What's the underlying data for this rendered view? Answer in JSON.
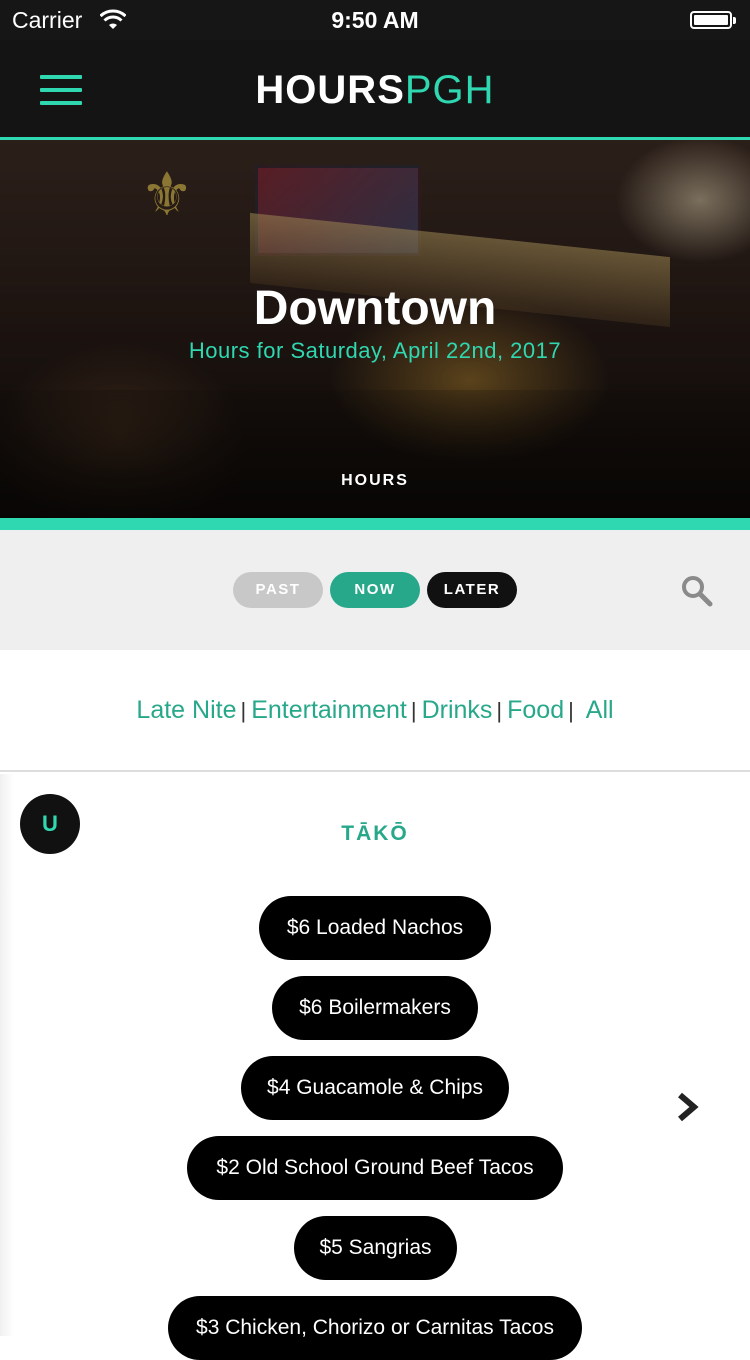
{
  "status_bar": {
    "carrier": "Carrier",
    "time": "9:50 AM",
    "icons": [
      "wifi-icon",
      "battery-icon"
    ]
  },
  "header": {
    "logo_main": "HOURS",
    "logo_accent": "PGH",
    "menu_icon": "hamburger-menu-icon",
    "colors": {
      "background": "#141414",
      "accent": "#2fd8b0"
    }
  },
  "hero": {
    "title": "Downtown",
    "subtitle": "Hours for Saturday, April 22nd, 2017",
    "tab_label": "HOURS"
  },
  "time_filter": {
    "past": "PAST",
    "now": "NOW",
    "later": "LATER",
    "selected": "NOW",
    "search_icon": "search-icon"
  },
  "categories": {
    "items": [
      "Late Nite",
      "Entertainment",
      "Drinks",
      "Food",
      "All"
    ],
    "separator": "|"
  },
  "venue": {
    "avatar_letter": "U",
    "name": "TĀKŌ",
    "deals": [
      "$6 Loaded Nachos",
      "$6 Boilermakers",
      "$4 Guacamole & Chips",
      "$2 Old School Ground Beef Tacos",
      "$5 Sangrias",
      "$3 Chicken, Chorizo or Carnitas Tacos"
    ],
    "next_icon": "chevron-right-icon"
  },
  "colors": {
    "teal": "#28a88a",
    "teal_bright": "#2fd8b0",
    "black": "#000000",
    "pill_inactive": "#c8c8c8"
  }
}
